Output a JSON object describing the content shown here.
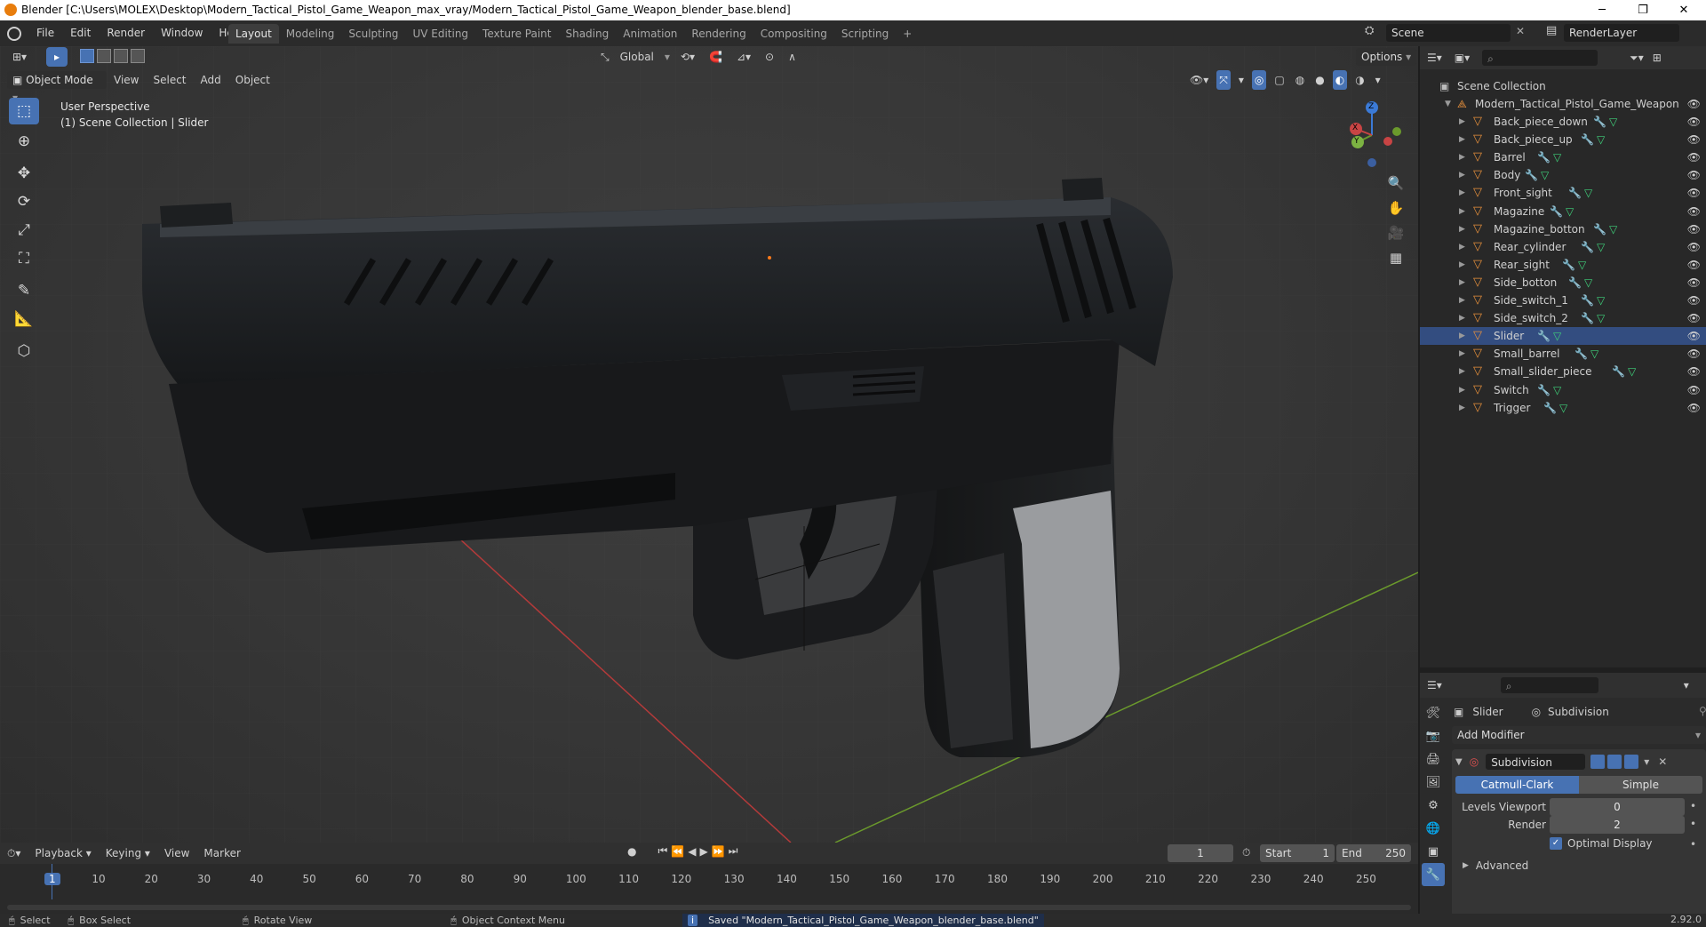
{
  "titlebar": {
    "title": "Blender [C:\\Users\\MOLEX\\Desktop\\Modern_Tactical_Pistol_Game_Weapon_max_vray/Modern_Tactical_Pistol_Game_Weapon_blender_base.blend]",
    "minimize": "─",
    "maximize": "❐",
    "close": "✕"
  },
  "menu": {
    "items": [
      "File",
      "Edit",
      "Render",
      "Window",
      "Help"
    ],
    "workspaces": [
      "Layout",
      "Modeling",
      "Sculpting",
      "UV Editing",
      "Texture Paint",
      "Shading",
      "Animation",
      "Rendering",
      "Compositing",
      "Scripting"
    ],
    "add_workspace": "+",
    "scene_label": "Scene",
    "view_layer": "RenderLayer"
  },
  "viewport": {
    "mode": "Object Mode",
    "menus": [
      "View",
      "Select",
      "Add",
      "Object"
    ],
    "transform_orientation": "Global",
    "options": "Options",
    "overlay_line1": "User Perspective",
    "overlay_line2": "(1) Scene Collection | Slider",
    "gizmo": {
      "x": "X",
      "y": "Y",
      "z": "Z"
    }
  },
  "outliner": {
    "root": "Scene Collection",
    "collection": "Modern_Tactical_Pistol_Game_Weapon",
    "objects": [
      {
        "name": "Back_piece_down",
        "selected": false
      },
      {
        "name": "Back_piece_up",
        "selected": false
      },
      {
        "name": "Barrel",
        "selected": false
      },
      {
        "name": "Body",
        "selected": false
      },
      {
        "name": "Front_sight",
        "selected": false
      },
      {
        "name": "Magazine",
        "selected": false
      },
      {
        "name": "Magazine_botton",
        "selected": false
      },
      {
        "name": "Rear_cylinder",
        "selected": false
      },
      {
        "name": "Rear_sight",
        "selected": false
      },
      {
        "name": "Side_botton",
        "selected": false
      },
      {
        "name": "Side_switch_1",
        "selected": false
      },
      {
        "name": "Side_switch_2",
        "selected": false
      },
      {
        "name": "Slider",
        "selected": true
      },
      {
        "name": "Small_barrel",
        "selected": false
      },
      {
        "name": "Small_slider_piece",
        "selected": false
      },
      {
        "name": "Switch",
        "selected": false
      },
      {
        "name": "Trigger",
        "selected": false
      }
    ]
  },
  "properties": {
    "breadcrumb_object": "Slider",
    "breadcrumb_modifier": "Subdivision",
    "add_modifier": "Add Modifier",
    "modifier_name": "Subdivision",
    "type_catmull": "Catmull-Clark",
    "type_simple": "Simple",
    "levels_viewport_label": "Levels Viewport",
    "levels_viewport_value": "0",
    "render_label": "Render",
    "render_value": "2",
    "optimal_display": "Optimal Display",
    "advanced": "Advanced"
  },
  "timeline": {
    "menus": [
      "Playback",
      "Keying",
      "View",
      "Marker"
    ],
    "current_frame": "1",
    "start_label": "Start",
    "start_value": "1",
    "end_label": "End",
    "end_value": "250",
    "ticks": [
      "1",
      "10",
      "20",
      "30",
      "40",
      "50",
      "60",
      "70",
      "80",
      "90",
      "100",
      "110",
      "120",
      "130",
      "140",
      "150",
      "160",
      "170",
      "180",
      "190",
      "200",
      "210",
      "220",
      "230",
      "240",
      "250"
    ]
  },
  "statusbar": {
    "select": "Select",
    "box_select": "Box Select",
    "rotate_view": "Rotate View",
    "context_menu": "Object Context Menu",
    "message": "Saved \"Modern_Tactical_Pistol_Game_Weapon_blender_base.blend\"",
    "version": "2.92.0"
  }
}
